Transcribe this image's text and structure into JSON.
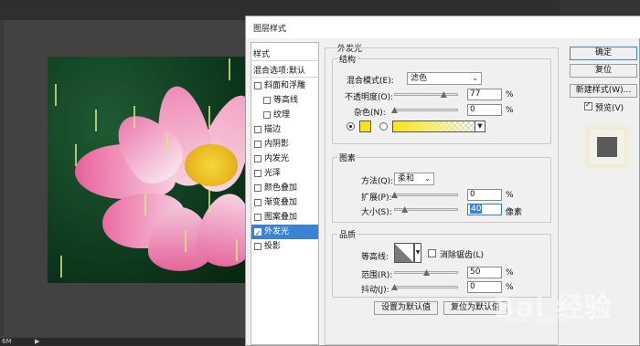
{
  "app": {
    "status_zoom": "6M",
    "status_arrow": "▶",
    "corner_label": "R"
  },
  "dialog": {
    "title": "图层样式",
    "styles_header": "样式",
    "blend_options": "混合选项:默认",
    "styles": [
      {
        "label": "斜面和浮雕",
        "checked": false,
        "indent": 0
      },
      {
        "label": "等高线",
        "checked": false,
        "indent": 1
      },
      {
        "label": "纹理",
        "checked": false,
        "indent": 1
      },
      {
        "label": "描边",
        "checked": false,
        "indent": 0
      },
      {
        "label": "内阴影",
        "checked": false,
        "indent": 0
      },
      {
        "label": "内发光",
        "checked": false,
        "indent": 0
      },
      {
        "label": "光泽",
        "checked": false,
        "indent": 0
      },
      {
        "label": "颜色叠加",
        "checked": false,
        "indent": 0
      },
      {
        "label": "渐变叠加",
        "checked": false,
        "indent": 0
      },
      {
        "label": "图案叠加",
        "checked": false,
        "indent": 0
      },
      {
        "label": "外发光",
        "checked": true,
        "indent": 0,
        "active": true
      },
      {
        "label": "投影",
        "checked": false,
        "indent": 0
      }
    ],
    "outer_glow": {
      "section_title": "外发光",
      "structure_title": "结构",
      "blend_mode_label": "混合模式(E):",
      "blend_mode_value": "滤色",
      "opacity_label": "不透明度(O):",
      "opacity_value": "77",
      "opacity_level": 77,
      "noise_label": "杂色(N):",
      "noise_value": "0",
      "noise_level": 0,
      "glow_color": "#f5e31e",
      "percent": "%",
      "elements_title": "图素",
      "technique_label": "方法(Q):",
      "technique_value": "柔和",
      "spread_label": "扩展(P):",
      "spread_value": "0",
      "spread_level": 0,
      "size_label": "大小(S):",
      "size_value": "40",
      "size_level": 16,
      "size_unit": "像素",
      "quality_title": "品质",
      "contour_label": "等高线:",
      "antialias_label": "消除锯齿(L)",
      "range_label": "范围(R):",
      "range_value": "50",
      "range_level": 50,
      "jitter_label": "抖动(J):",
      "jitter_value": "0",
      "jitter_level": 0,
      "make_default": "设置为默认值",
      "reset_default": "复位为默认值"
    },
    "buttons": {
      "ok": "确定",
      "reset": "复位",
      "new_style": "新建样式(W)...",
      "preview_label": "预览(V)"
    }
  },
  "watermark": {
    "text": "Bai 经验",
    "sub": "jingyan.baidu.com"
  },
  "colors": {
    "accent": "#3a83d4",
    "glow_yellow": "#f5e31e"
  }
}
